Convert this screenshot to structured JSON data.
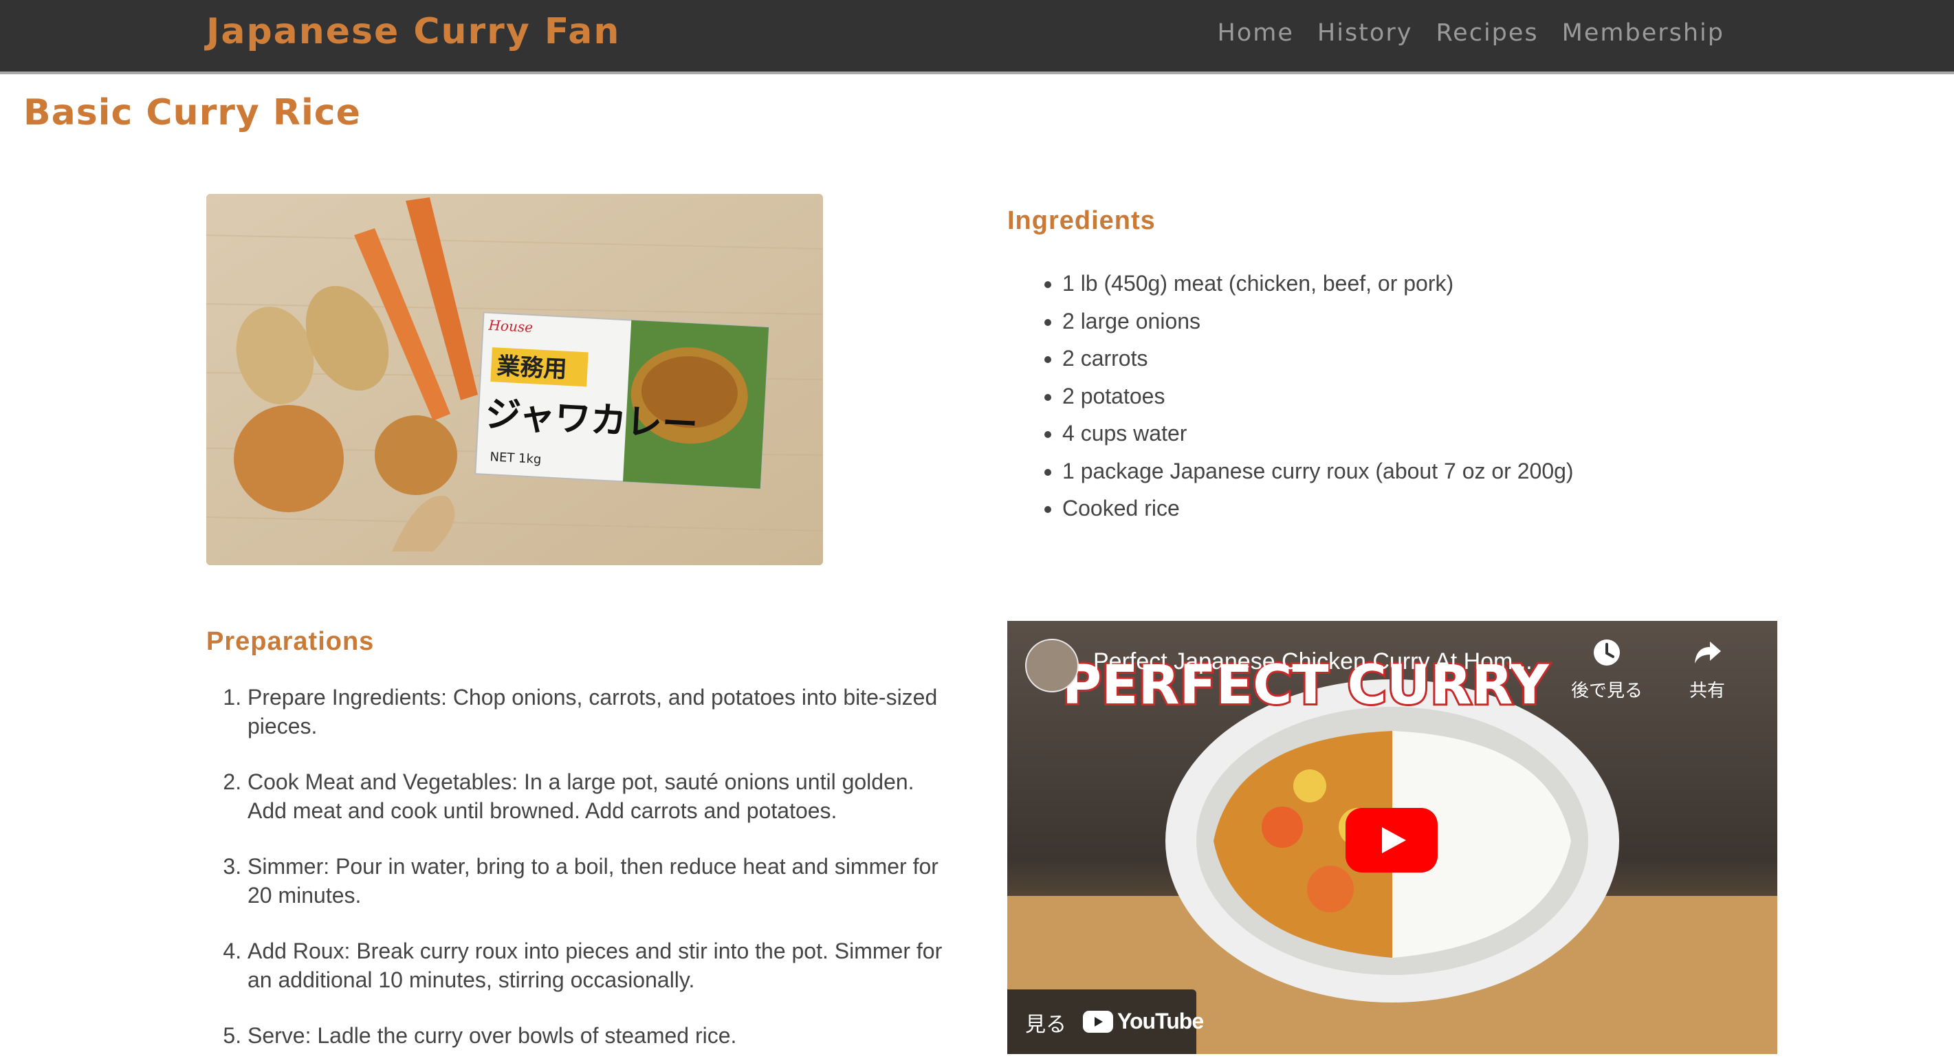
{
  "header": {
    "brand": "Japanese Curry Fan",
    "nav": [
      "Home",
      "History",
      "Recipes",
      "Membership"
    ]
  },
  "page": {
    "title": "Basic Curry Rice"
  },
  "photo": {
    "package_brand": "House",
    "package_title": "業務用",
    "package_name": "ジャワカレー",
    "package_net": "NET 1kg"
  },
  "ingredients": {
    "heading": "Ingredients",
    "items": [
      "1 lb (450g) meat (chicken, beef, or pork)",
      "2 large onions",
      "2 carrots",
      "2 potatoes",
      "4 cups water",
      "1 package Japanese curry roux (about 7 oz or 200g)",
      "Cooked rice"
    ]
  },
  "preparations": {
    "heading": "Preparations",
    "steps": [
      "Prepare Ingredients: Chop onions, carrots, and potatoes into bite-sized pieces.",
      "Cook Meat and Vegetables: In a large pot, sauté onions until golden. Add meat and cook until browned. Add carrots and potatoes.",
      "Simmer: Pour in water, bring to a boil, then reduce heat and simmer for 20 minutes.",
      "Add Roux: Break curry roux into pieces and stir into the pot. Simmer for an additional 10 minutes, stirring occasionally.",
      "Serve: Ladle the curry over bowls of steamed rice."
    ]
  },
  "video": {
    "title": "Perfect Japanese Chicken Curry At Hom...",
    "thumbnail_text": "PERFECT CURRY",
    "watch_later": "後で見る",
    "share": "共有",
    "watch_on": "見る",
    "platform": "YouTube"
  },
  "colors": {
    "accent": "#cc7a35",
    "header_bg": "#333333",
    "nav_text": "#9a9a9a",
    "youtube_red": "#ff0000"
  }
}
